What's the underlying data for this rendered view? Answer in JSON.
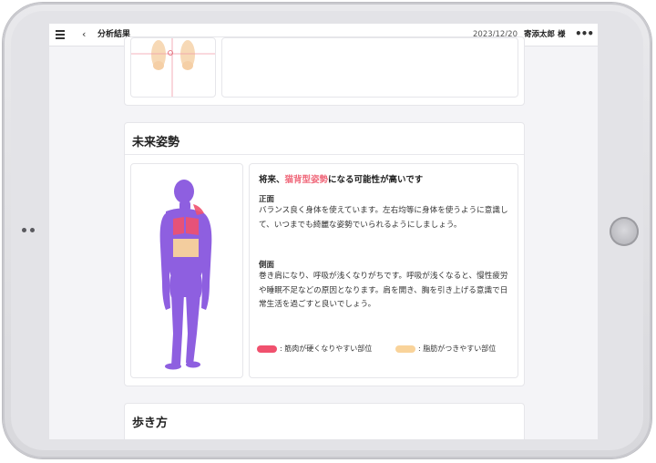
{
  "header": {
    "title": "分析結果",
    "date": "2023/12/20",
    "user": "寄添太郎 様"
  },
  "future_posture": {
    "section_title": "未来姿勢",
    "headline_prefix": "将来、",
    "headline_accent": "猫背型姿勢",
    "headline_suffix": "になる可能性が高いです",
    "front_label": "正面",
    "front_text": "バランス良く身体を使えています。左右均等に身体を使うように意識して、いつまでも綺麗な姿勢でいられるようにしましょう。",
    "side_label": "側面",
    "side_text": "巻き肩になり、呼吸が浅くなりがちです。呼吸が浅くなると、慢性疲労や睡眠不足などの原因となります。肩を開き、胸を引き上げる意識で日常生活を過ごすと良いでしょう。",
    "legend": [
      {
        "label": ": 筋肉が硬くなりやすい部位",
        "color": "#f0516e"
      },
      {
        "label": ": 脂肪がつきやすい部位",
        "color": "#f9d39a"
      }
    ]
  },
  "walking": {
    "section_title": "歩き方"
  },
  "colors": {
    "accent": "#f06a7c",
    "body_figure": "#8e5fe0"
  }
}
